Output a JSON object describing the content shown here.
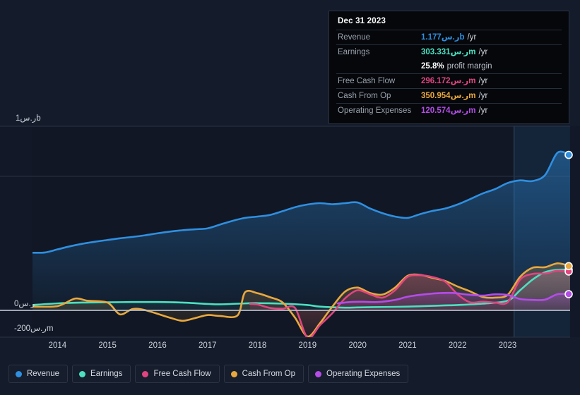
{
  "tooltip": {
    "date": "Dec 31 2023",
    "rows": [
      {
        "label": "Revenue",
        "value": "1.177ر.سb",
        "unit": "/yr",
        "color": "#2f8fe0"
      },
      {
        "label": "Earnings",
        "value": "303.331ر.سm",
        "unit": "/yr",
        "color": "#4ce0c0"
      },
      {
        "label": "",
        "value": "25.8%",
        "unit": "profit margin",
        "color": "#ffffff",
        "sub": true
      },
      {
        "label": "Free Cash Flow",
        "value": "296.172ر.سm",
        "unit": "/yr",
        "color": "#e0457f"
      },
      {
        "label": "Cash From Op",
        "value": "350.954ر.سm",
        "unit": "/yr",
        "color": "#e8a83e"
      },
      {
        "label": "Operating Expenses",
        "value": "120.574ر.سm",
        "unit": "/yr",
        "color": "#b44ce8"
      }
    ]
  },
  "axis": {
    "y_labels": [
      {
        "text": "1ر.سb",
        "x": 22,
        "y": 160
      },
      {
        "text": "0ر.س",
        "x": 20,
        "y": 423
      },
      {
        "text": "-200ر.سm",
        "x": 20,
        "y": 458
      }
    ],
    "x_labels": [
      "2014",
      "2015",
      "2016",
      "2017",
      "2018",
      "2019",
      "2020",
      "2021",
      "2022",
      "2023"
    ]
  },
  "legend": {
    "items": [
      {
        "label": "Revenue",
        "color": "#2f8fe0"
      },
      {
        "label": "Earnings",
        "color": "#4ce0c0"
      },
      {
        "label": "Free Cash Flow",
        "color": "#e0457f"
      },
      {
        "label": "Cash From Op",
        "color": "#e8a83e"
      },
      {
        "label": "Operating Expenses",
        "color": "#b44ce8"
      }
    ]
  },
  "chart_data": {
    "type": "area",
    "title": "",
    "xlabel": "",
    "ylabel": "ر.س",
    "currency": "ر.س",
    "xlim": [
      2013.5,
      2024.25
    ],
    "ylim": [
      -280,
      1380
    ],
    "y_unit": "millions",
    "gridlines_y": [
      1000,
      600,
      0,
      -200
    ],
    "zero_line": 0,
    "forecast_start": 2023.13,
    "x_tick_values": [
      2014,
      2015,
      2016,
      2017,
      2018,
      2019,
      2020,
      2021,
      2022,
      2023
    ],
    "series": [
      {
        "name": "Revenue",
        "color": "#2f8fe0",
        "final_value": 1177,
        "points": [
          [
            2013.5,
            430
          ],
          [
            2013.75,
            432
          ],
          [
            2014.0,
            455
          ],
          [
            2014.25,
            478
          ],
          [
            2014.5,
            497
          ],
          [
            2014.75,
            512
          ],
          [
            2015.0,
            525
          ],
          [
            2015.25,
            538
          ],
          [
            2015.5,
            548
          ],
          [
            2015.75,
            560
          ],
          [
            2016.0,
            575
          ],
          [
            2016.25,
            588
          ],
          [
            2016.5,
            598
          ],
          [
            2016.75,
            605
          ],
          [
            2017.0,
            612
          ],
          [
            2017.25,
            640
          ],
          [
            2017.5,
            668
          ],
          [
            2017.75,
            690
          ],
          [
            2018.0,
            700
          ],
          [
            2018.25,
            712
          ],
          [
            2018.5,
            740
          ],
          [
            2018.75,
            770
          ],
          [
            2019.0,
            790
          ],
          [
            2019.25,
            800
          ],
          [
            2019.5,
            792
          ],
          [
            2019.75,
            800
          ],
          [
            2020.0,
            805
          ],
          [
            2020.25,
            760
          ],
          [
            2020.5,
            725
          ],
          [
            2020.75,
            700
          ],
          [
            2021.0,
            690
          ],
          [
            2021.25,
            718
          ],
          [
            2021.5,
            742
          ],
          [
            2021.75,
            760
          ],
          [
            2022.0,
            790
          ],
          [
            2022.25,
            830
          ],
          [
            2022.5,
            872
          ],
          [
            2022.75,
            905
          ],
          [
            2023.0,
            950
          ],
          [
            2023.25,
            970
          ],
          [
            2023.5,
            965
          ],
          [
            2023.75,
            1010
          ],
          [
            2024.0,
            1177
          ],
          [
            2024.25,
            1160
          ]
        ]
      },
      {
        "name": "Earnings",
        "color": "#4ce0c0",
        "final_value": 303.331,
        "points": [
          [
            2013.5,
            40
          ],
          [
            2014.0,
            52
          ],
          [
            2014.5,
            58
          ],
          [
            2015.0,
            60
          ],
          [
            2015.5,
            62
          ],
          [
            2016.0,
            62
          ],
          [
            2016.5,
            58
          ],
          [
            2017.0,
            48
          ],
          [
            2017.25,
            45
          ],
          [
            2017.75,
            52
          ],
          [
            2018.0,
            54
          ],
          [
            2018.5,
            50
          ],
          [
            2019.0,
            40
          ],
          [
            2019.25,
            28
          ],
          [
            2019.75,
            20
          ],
          [
            2020.0,
            22
          ],
          [
            2020.5,
            25
          ],
          [
            2021.0,
            28
          ],
          [
            2021.5,
            34
          ],
          [
            2022.0,
            40
          ],
          [
            2022.5,
            50
          ],
          [
            2023.0,
            72
          ],
          [
            2023.25,
            150
          ],
          [
            2023.5,
            230
          ],
          [
            2023.75,
            285
          ],
          [
            2024.0,
            303
          ],
          [
            2024.25,
            303
          ]
        ]
      },
      {
        "name": "Free Cash Flow",
        "color": "#e0457f",
        "final_value": 296.172,
        "start_x": 2017.85,
        "points": [
          [
            2017.85,
            48
          ],
          [
            2018.0,
            44
          ],
          [
            2018.25,
            18
          ],
          [
            2018.5,
            12
          ],
          [
            2018.75,
            18
          ],
          [
            2019.0,
            -205
          ],
          [
            2019.25,
            -110
          ],
          [
            2019.5,
            -20
          ],
          [
            2019.75,
            90
          ],
          [
            2020.0,
            150
          ],
          [
            2020.25,
            120
          ],
          [
            2020.5,
            95
          ],
          [
            2020.75,
            150
          ],
          [
            2021.0,
            250
          ],
          [
            2021.25,
            262
          ],
          [
            2021.5,
            248
          ],
          [
            2021.75,
            215
          ],
          [
            2022.0,
            120
          ],
          [
            2022.25,
            60
          ],
          [
            2022.5,
            65
          ],
          [
            2022.75,
            58
          ],
          [
            2023.0,
            60
          ],
          [
            2023.25,
            230
          ],
          [
            2023.5,
            272
          ],
          [
            2023.75,
            275
          ],
          [
            2024.0,
            296
          ],
          [
            2024.25,
            290
          ]
        ]
      },
      {
        "name": "Cash From Op",
        "color": "#e8a83e",
        "final_value": 350.954,
        "points": [
          [
            2013.5,
            28
          ],
          [
            2014.0,
            32
          ],
          [
            2014.35,
            88
          ],
          [
            2014.6,
            72
          ],
          [
            2015.0,
            58
          ],
          [
            2015.25,
            -30
          ],
          [
            2015.5,
            10
          ],
          [
            2015.75,
            2
          ],
          [
            2016.25,
            -55
          ],
          [
            2016.5,
            -78
          ],
          [
            2016.75,
            -58
          ],
          [
            2017.0,
            -35
          ],
          [
            2017.25,
            -42
          ],
          [
            2017.6,
            -38
          ],
          [
            2017.75,
            135
          ],
          [
            2018.0,
            128
          ],
          [
            2018.25,
            98
          ],
          [
            2018.5,
            60
          ],
          [
            2018.75,
            -55
          ],
          [
            2019.0,
            -195
          ],
          [
            2019.25,
            -95
          ],
          [
            2019.5,
            30
          ],
          [
            2019.75,
            140
          ],
          [
            2020.0,
            170
          ],
          [
            2020.25,
            130
          ],
          [
            2020.5,
            118
          ],
          [
            2020.75,
            170
          ],
          [
            2021.0,
            258
          ],
          [
            2021.25,
            265
          ],
          [
            2021.5,
            242
          ],
          [
            2021.75,
            220
          ],
          [
            2022.0,
            178
          ],
          [
            2022.25,
            142
          ],
          [
            2022.5,
            100
          ],
          [
            2022.75,
            95
          ],
          [
            2023.0,
            115
          ],
          [
            2023.25,
            250
          ],
          [
            2023.5,
            318
          ],
          [
            2023.75,
            322
          ],
          [
            2024.0,
            351
          ],
          [
            2024.25,
            330
          ]
        ]
      },
      {
        "name": "Operating Expenses",
        "color": "#b44ce8",
        "final_value": 120.574,
        "start_x": 2019.6,
        "points": [
          [
            2019.6,
            52
          ],
          [
            2019.85,
            62
          ],
          [
            2020.1,
            64
          ],
          [
            2020.4,
            62
          ],
          [
            2020.75,
            78
          ],
          [
            2021.0,
            102
          ],
          [
            2021.3,
            118
          ],
          [
            2021.6,
            128
          ],
          [
            2021.9,
            130
          ],
          [
            2022.2,
            118
          ],
          [
            2022.5,
            110
          ],
          [
            2022.75,
            120
          ],
          [
            2023.0,
            115
          ],
          [
            2023.25,
            85
          ],
          [
            2023.5,
            78
          ],
          [
            2023.75,
            80
          ],
          [
            2024.0,
            121
          ],
          [
            2024.25,
            121
          ]
        ]
      }
    ]
  }
}
